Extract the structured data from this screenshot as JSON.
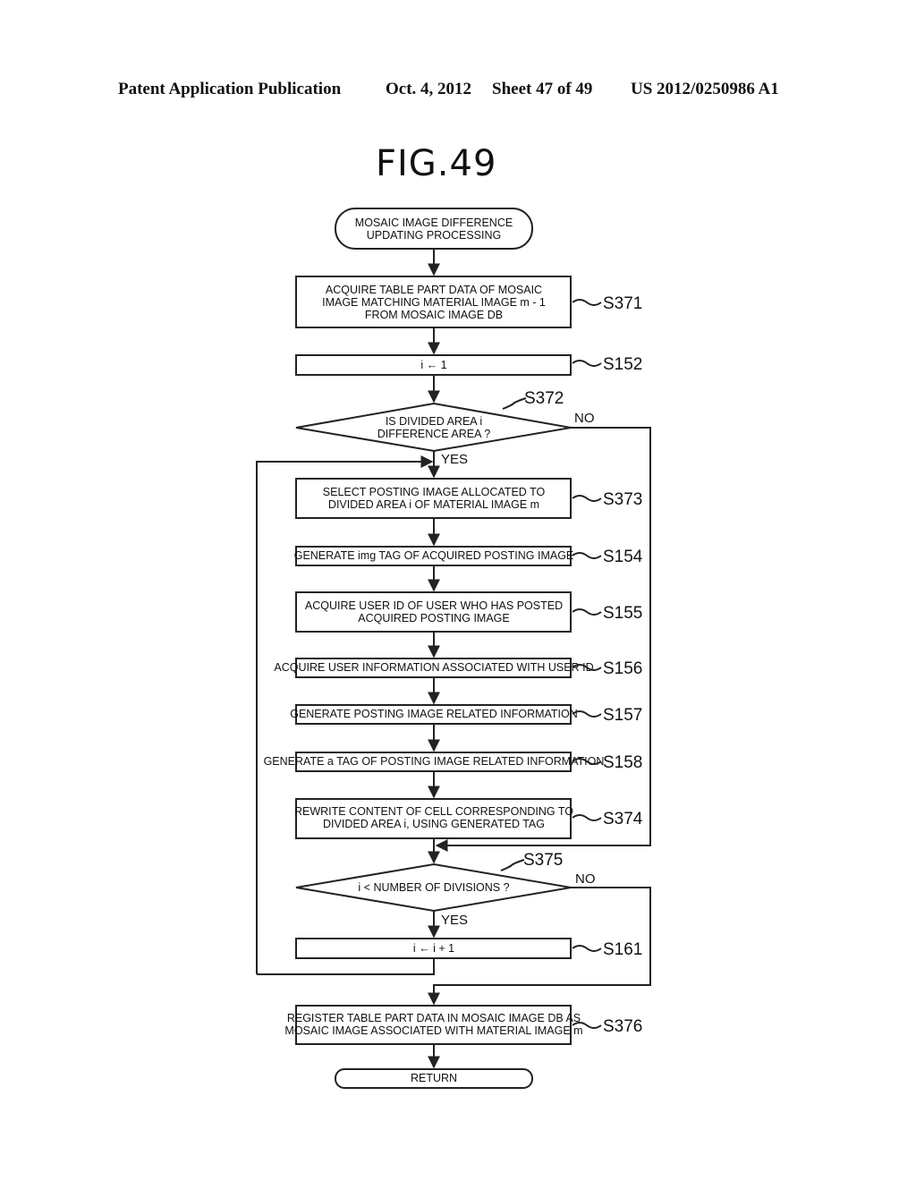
{
  "header": {
    "publication": "Patent Application Publication",
    "date": "Oct. 4, 2012",
    "sheet": "Sheet 47 of 49",
    "number": "US 2012/0250986 A1"
  },
  "figure": {
    "title": "FIG.49"
  },
  "flow": {
    "start": [
      "MOSAIC IMAGE DIFFERENCE",
      "UPDATING PROCESSING"
    ],
    "steps": {
      "S371": {
        "label": "S371",
        "lines": [
          "ACQUIRE TABLE PART DATA OF MOSAIC",
          "IMAGE MATCHING MATERIAL IMAGE m - 1",
          "FROM MOSAIC IMAGE DB"
        ]
      },
      "S152": {
        "label": "S152",
        "lines": [
          "i ← 1"
        ]
      },
      "S372": {
        "label": "S372",
        "lines": [
          "IS DIVIDED AREA i",
          "DIFFERENCE AREA ?"
        ],
        "yes": "YES",
        "no": "NO"
      },
      "S373": {
        "label": "S373",
        "lines": [
          "SELECT POSTING IMAGE ALLOCATED TO",
          "DIVIDED AREA i OF MATERIAL IMAGE m"
        ]
      },
      "S154": {
        "label": "S154",
        "lines": [
          "GENERATE img TAG OF ACQUIRED POSTING IMAGE"
        ]
      },
      "S155": {
        "label": "S155",
        "lines": [
          "ACQUIRE USER ID OF USER WHO HAS POSTED",
          "ACQUIRED POSTING IMAGE"
        ]
      },
      "S156": {
        "label": "S156",
        "lines": [
          "ACQUIRE USER INFORMATION ASSOCIATED WITH USER ID"
        ]
      },
      "S157": {
        "label": "S157",
        "lines": [
          "GENERATE POSTING IMAGE RELATED INFORMATION"
        ]
      },
      "S158": {
        "label": "S158",
        "lines": [
          "GENERATE a TAG OF POSTING IMAGE RELATED INFORMATION"
        ]
      },
      "S374": {
        "label": "S374",
        "lines": [
          "REWRITE CONTENT OF CELL CORRESPONDING TO",
          "DIVIDED AREA i, USING GENERATED TAG"
        ]
      },
      "S375": {
        "label": "S375",
        "lines": [
          "i < NUMBER OF DIVISIONS ?"
        ],
        "yes": "YES",
        "no": "NO"
      },
      "S161": {
        "label": "S161",
        "lines": [
          "i ← i + 1"
        ]
      },
      "S376": {
        "label": "S376",
        "lines": [
          "REGISTER TABLE PART DATA IN MOSAIC IMAGE DB AS",
          "MOSAIC IMAGE ASSOCIATED WITH MATERIAL IMAGE m"
        ]
      }
    },
    "end": [
      "RETURN"
    ]
  }
}
